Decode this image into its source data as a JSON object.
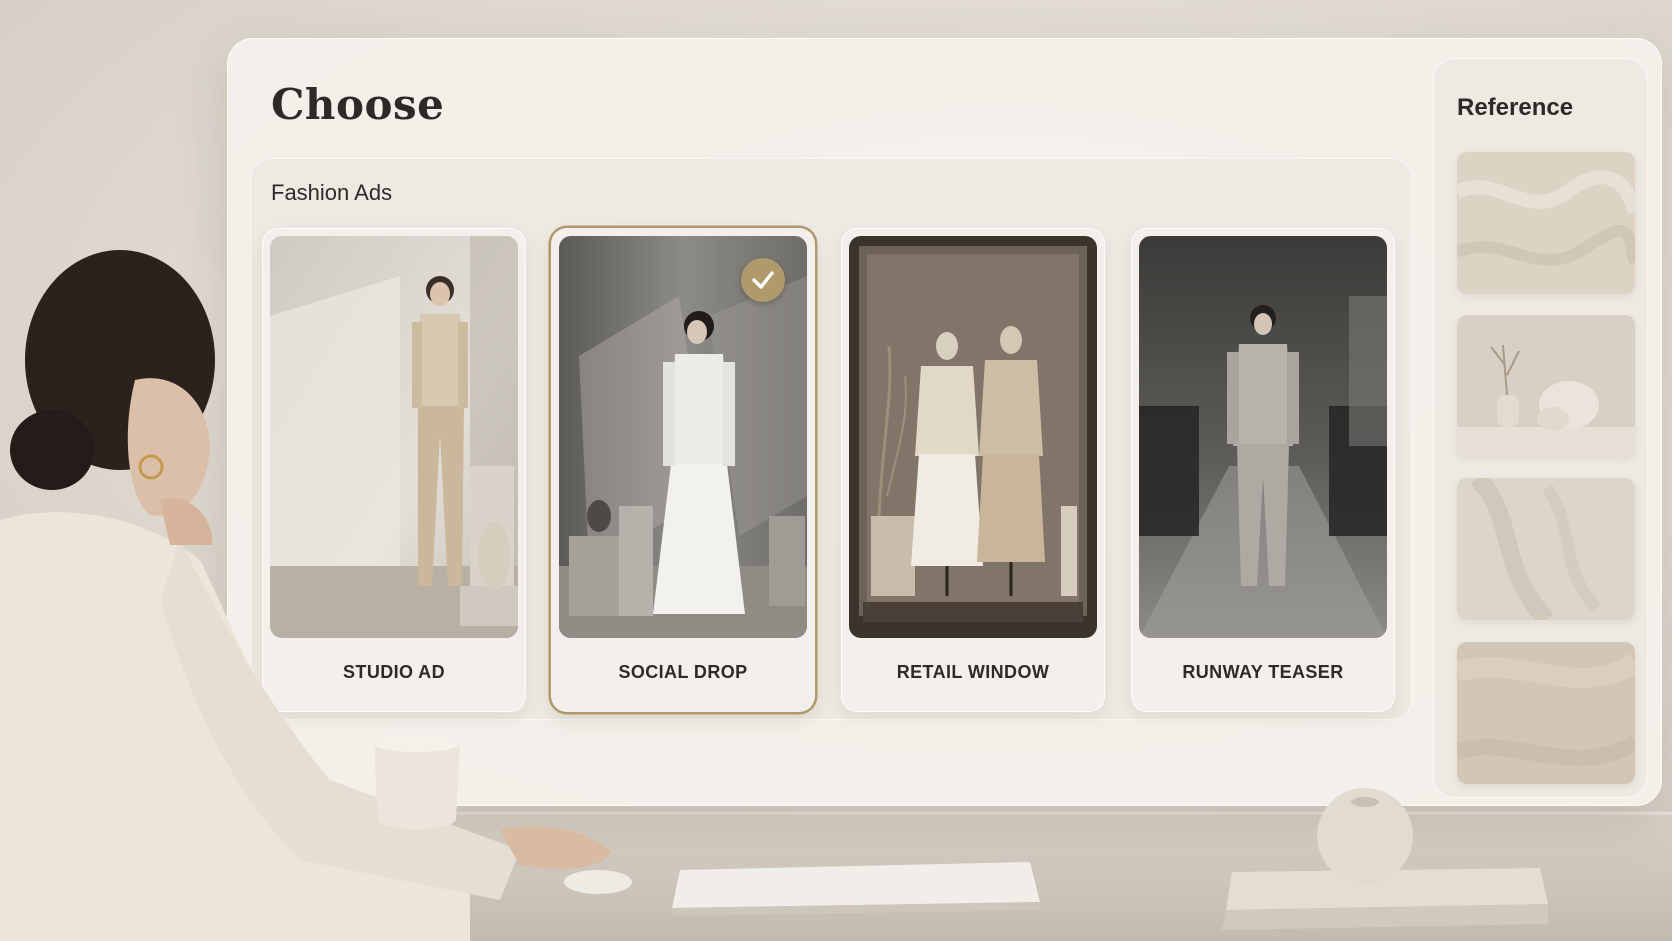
{
  "page": {
    "title": "Choose"
  },
  "section": {
    "title": "Fashion Ads"
  },
  "cards": [
    {
      "label": "STUDIO AD",
      "selected": false,
      "scene": "model-in-beige-suit-studio"
    },
    {
      "label": "SOCIAL DROP",
      "selected": true,
      "scene": "model-in-white-blazer-skirt-shadows"
    },
    {
      "label": "RETAIL WINDOW",
      "selected": false,
      "scene": "mannequins-in-shop-window"
    },
    {
      "label": "RUNWAY TEASER",
      "selected": false,
      "scene": "model-walking-runway"
    }
  ],
  "reference": {
    "title": "Reference",
    "swatches": [
      {
        "name": "fabric-texture",
        "color": "#ddd3c5"
      },
      {
        "name": "ceramic-still-life",
        "color": "#d8d0c4"
      },
      {
        "name": "leaf-shadow-wall",
        "color": "#dcd5ca"
      },
      {
        "name": "sand-texture",
        "color": "#d2c7b6"
      }
    ]
  },
  "icons": {
    "selected_check": "check-icon"
  },
  "colors": {
    "accent": "#b09a6c",
    "panel": "#f4f1ec",
    "text": "#2e2b27"
  }
}
